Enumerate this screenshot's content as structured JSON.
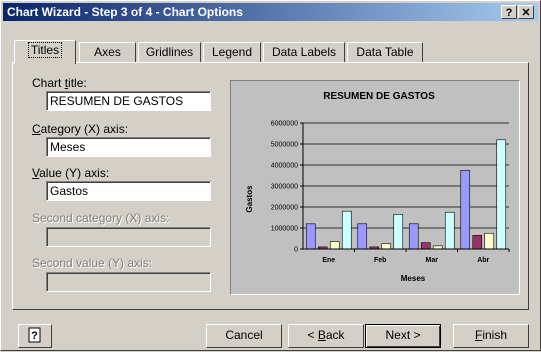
{
  "window": {
    "title": "Chart Wizard - Step 3 of 4 - Chart Options",
    "help_glyph": "?",
    "close_glyph": "✕"
  },
  "tabs": [
    "Titles",
    "Axes",
    "Gridlines",
    "Legend",
    "Data Labels",
    "Data Table"
  ],
  "fields": {
    "chart_title": {
      "label_pre": "Chart ",
      "label_u": "t",
      "label_post": "itle:",
      "value": "RESUMEN DE GASTOS"
    },
    "category_x": {
      "label_pre": "",
      "label_u": "C",
      "label_post": "ategory (X) axis:",
      "value": "Meses"
    },
    "value_y": {
      "label_pre": "",
      "label_u": "V",
      "label_post": "alue (Y) axis:",
      "value": "Gastos"
    },
    "second_category_x": {
      "label": "Second category (X) axis:",
      "value": ""
    },
    "second_value_y": {
      "label": "Second value (Y) axis:",
      "value": ""
    }
  },
  "buttons": {
    "help_icon": "office-assistant-icon",
    "cancel": "Cancel",
    "back_pre": "< ",
    "back_u": "B",
    "back_post": "ack",
    "next": "Next >",
    "finish_u": "F",
    "finish_post": "inish"
  },
  "colors": {
    "title_start": "#0a246a",
    "title_end": "#a6caf0",
    "face": "#d4d0c8",
    "plot_bg": "#c0c0c0"
  },
  "chart_data": {
    "type": "bar",
    "title": "RESUMEN DE GASTOS",
    "xlabel": "Meses",
    "ylabel": "Gastos",
    "categories": [
      "Ene",
      "Feb",
      "Mar",
      "Abr"
    ],
    "ylim": [
      0,
      6000000
    ],
    "yticks": [
      "0",
      "1000000",
      "2000000",
      "3000000",
      "4000000",
      "5000000",
      "6000000"
    ],
    "grid": true,
    "series": [
      {
        "color": "#9999ff",
        "values": [
          1200000,
          1200000,
          1200000,
          3750000
        ]
      },
      {
        "color": "#993366",
        "values": [
          100000,
          100000,
          300000,
          650000
        ]
      },
      {
        "color": "#ffffcc",
        "values": [
          350000,
          250000,
          150000,
          750000
        ]
      },
      {
        "color": "#ccffff",
        "values": [
          1800000,
          1650000,
          1750000,
          5200000
        ]
      }
    ]
  }
}
